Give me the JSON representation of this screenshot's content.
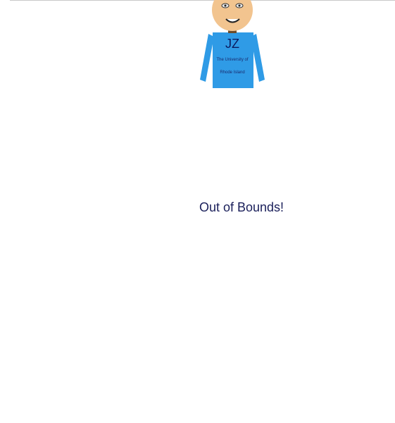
{
  "character": {
    "initials": "JZ",
    "shirt_text_line1": "The University of",
    "shirt_text_line2": "Rhode Island",
    "shirt_color": "#2f9be6",
    "skin_color": "#f2c48f"
  },
  "status": {
    "message": "Out of Bounds!"
  }
}
